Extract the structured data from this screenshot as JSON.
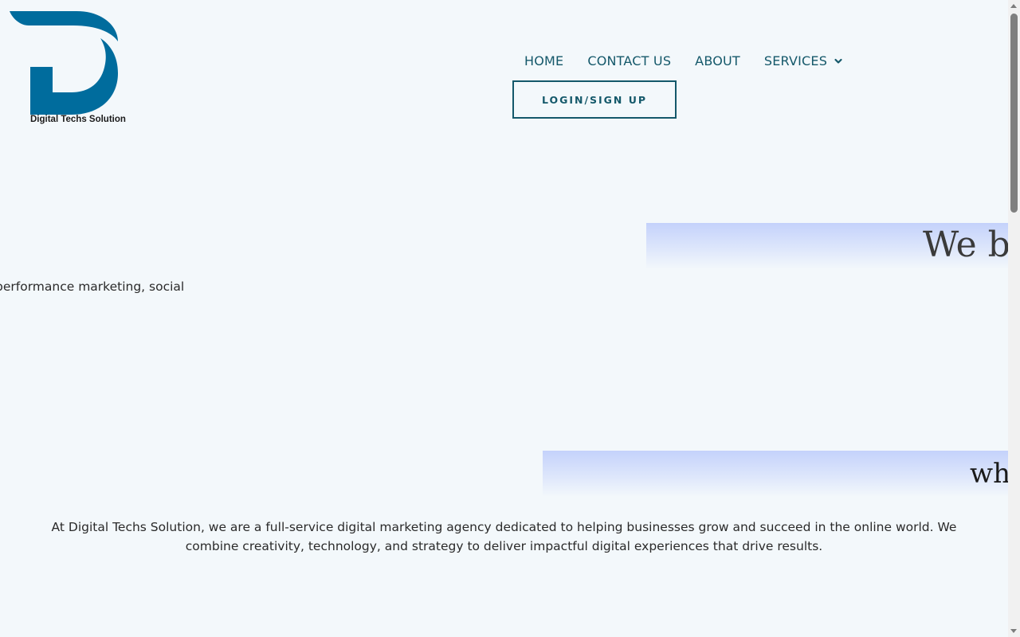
{
  "brand": {
    "logo_text": "Digital Techs Solution",
    "color": "#006c9d"
  },
  "nav": {
    "items": [
      {
        "label": "HOME"
      },
      {
        "label": "CONTACT US"
      },
      {
        "label": "ABOUT"
      },
      {
        "label": "SERVICES"
      }
    ],
    "services_icon": "chevron-down-icon",
    "login_label": "LOGIN/SIGN UP",
    "color": "#14586a"
  },
  "hero": {
    "headline_1": "We bu",
    "headline_2": "wha",
    "snippet": "performance marketing, social"
  },
  "about": {
    "paragraph": "At Digital Techs Solution, we are a full-service digital marketing agency dedicated to helping businesses grow and succeed in the online world. We combine creativity, technology, and strategy to deliver impactful digital experiences that drive results."
  },
  "colors": {
    "background": "#f3f8fb",
    "band_gradient_top": "#c4d2fb"
  }
}
